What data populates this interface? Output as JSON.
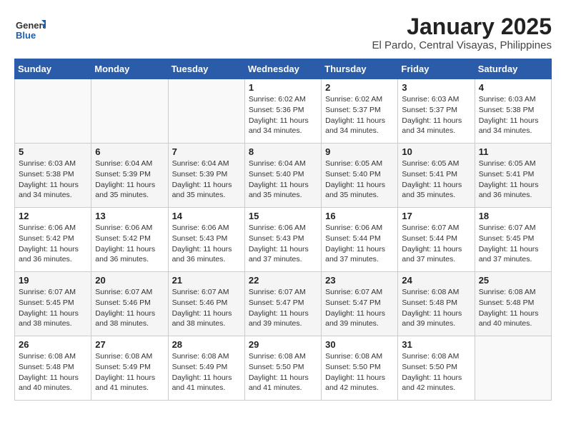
{
  "logo": {
    "general": "General",
    "blue": "Blue"
  },
  "title": "January 2025",
  "subtitle": "El Pardo, Central Visayas, Philippines",
  "days_of_week": [
    "Sunday",
    "Monday",
    "Tuesday",
    "Wednesday",
    "Thursday",
    "Friday",
    "Saturday"
  ],
  "weeks": [
    [
      {
        "day": "",
        "info": ""
      },
      {
        "day": "",
        "info": ""
      },
      {
        "day": "",
        "info": ""
      },
      {
        "day": "1",
        "info": "Sunrise: 6:02 AM\nSunset: 5:36 PM\nDaylight: 11 hours\nand 34 minutes."
      },
      {
        "day": "2",
        "info": "Sunrise: 6:02 AM\nSunset: 5:37 PM\nDaylight: 11 hours\nand 34 minutes."
      },
      {
        "day": "3",
        "info": "Sunrise: 6:03 AM\nSunset: 5:37 PM\nDaylight: 11 hours\nand 34 minutes."
      },
      {
        "day": "4",
        "info": "Sunrise: 6:03 AM\nSunset: 5:38 PM\nDaylight: 11 hours\nand 34 minutes."
      }
    ],
    [
      {
        "day": "5",
        "info": "Sunrise: 6:03 AM\nSunset: 5:38 PM\nDaylight: 11 hours\nand 34 minutes."
      },
      {
        "day": "6",
        "info": "Sunrise: 6:04 AM\nSunset: 5:39 PM\nDaylight: 11 hours\nand 35 minutes."
      },
      {
        "day": "7",
        "info": "Sunrise: 6:04 AM\nSunset: 5:39 PM\nDaylight: 11 hours\nand 35 minutes."
      },
      {
        "day": "8",
        "info": "Sunrise: 6:04 AM\nSunset: 5:40 PM\nDaylight: 11 hours\nand 35 minutes."
      },
      {
        "day": "9",
        "info": "Sunrise: 6:05 AM\nSunset: 5:40 PM\nDaylight: 11 hours\nand 35 minutes."
      },
      {
        "day": "10",
        "info": "Sunrise: 6:05 AM\nSunset: 5:41 PM\nDaylight: 11 hours\nand 35 minutes."
      },
      {
        "day": "11",
        "info": "Sunrise: 6:05 AM\nSunset: 5:41 PM\nDaylight: 11 hours\nand 36 minutes."
      }
    ],
    [
      {
        "day": "12",
        "info": "Sunrise: 6:06 AM\nSunset: 5:42 PM\nDaylight: 11 hours\nand 36 minutes."
      },
      {
        "day": "13",
        "info": "Sunrise: 6:06 AM\nSunset: 5:42 PM\nDaylight: 11 hours\nand 36 minutes."
      },
      {
        "day": "14",
        "info": "Sunrise: 6:06 AM\nSunset: 5:43 PM\nDaylight: 11 hours\nand 36 minutes."
      },
      {
        "day": "15",
        "info": "Sunrise: 6:06 AM\nSunset: 5:43 PM\nDaylight: 11 hours\nand 37 minutes."
      },
      {
        "day": "16",
        "info": "Sunrise: 6:06 AM\nSunset: 5:44 PM\nDaylight: 11 hours\nand 37 minutes."
      },
      {
        "day": "17",
        "info": "Sunrise: 6:07 AM\nSunset: 5:44 PM\nDaylight: 11 hours\nand 37 minutes."
      },
      {
        "day": "18",
        "info": "Sunrise: 6:07 AM\nSunset: 5:45 PM\nDaylight: 11 hours\nand 37 minutes."
      }
    ],
    [
      {
        "day": "19",
        "info": "Sunrise: 6:07 AM\nSunset: 5:45 PM\nDaylight: 11 hours\nand 38 minutes."
      },
      {
        "day": "20",
        "info": "Sunrise: 6:07 AM\nSunset: 5:46 PM\nDaylight: 11 hours\nand 38 minutes."
      },
      {
        "day": "21",
        "info": "Sunrise: 6:07 AM\nSunset: 5:46 PM\nDaylight: 11 hours\nand 38 minutes."
      },
      {
        "day": "22",
        "info": "Sunrise: 6:07 AM\nSunset: 5:47 PM\nDaylight: 11 hours\nand 39 minutes."
      },
      {
        "day": "23",
        "info": "Sunrise: 6:07 AM\nSunset: 5:47 PM\nDaylight: 11 hours\nand 39 minutes."
      },
      {
        "day": "24",
        "info": "Sunrise: 6:08 AM\nSunset: 5:48 PM\nDaylight: 11 hours\nand 39 minutes."
      },
      {
        "day": "25",
        "info": "Sunrise: 6:08 AM\nSunset: 5:48 PM\nDaylight: 11 hours\nand 40 minutes."
      }
    ],
    [
      {
        "day": "26",
        "info": "Sunrise: 6:08 AM\nSunset: 5:48 PM\nDaylight: 11 hours\nand 40 minutes."
      },
      {
        "day": "27",
        "info": "Sunrise: 6:08 AM\nSunset: 5:49 PM\nDaylight: 11 hours\nand 41 minutes."
      },
      {
        "day": "28",
        "info": "Sunrise: 6:08 AM\nSunset: 5:49 PM\nDaylight: 11 hours\nand 41 minutes."
      },
      {
        "day": "29",
        "info": "Sunrise: 6:08 AM\nSunset: 5:50 PM\nDaylight: 11 hours\nand 41 minutes."
      },
      {
        "day": "30",
        "info": "Sunrise: 6:08 AM\nSunset: 5:50 PM\nDaylight: 11 hours\nand 42 minutes."
      },
      {
        "day": "31",
        "info": "Sunrise: 6:08 AM\nSunset: 5:50 PM\nDaylight: 11 hours\nand 42 minutes."
      },
      {
        "day": "",
        "info": ""
      }
    ]
  ]
}
